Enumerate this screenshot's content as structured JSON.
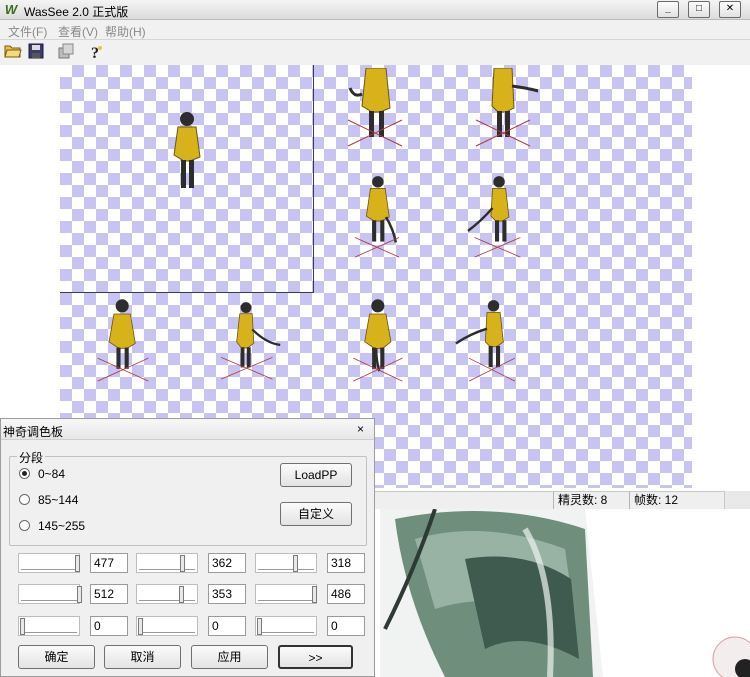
{
  "window": {
    "title": "WasSee 2.0 正式版"
  },
  "menu": {
    "file": "文件(F)",
    "view": "查看(V)",
    "help": "帮助(H)"
  },
  "status": {
    "sprites": "精灵数: 8",
    "frames": "帧数: 12"
  },
  "palette": {
    "title": "神奇调色板",
    "close": "×",
    "group_label": "分段",
    "ranges": [
      "0~84",
      "85~144",
      "145~255"
    ],
    "selected_range": "0~84",
    "load_label": "LoadPP",
    "custom_label": "自定义",
    "values": {
      "row1": [
        "477",
        "362",
        "318"
      ],
      "row2": [
        "512",
        "353",
        "486"
      ],
      "row3": [
        "0",
        "0",
        "0"
      ]
    },
    "ok_label": "确定",
    "cancel_label": "取消",
    "apply_label": "应用",
    "more_label": ">>"
  },
  "colors": {
    "checker": "#c7c3f2",
    "sprite_gold": "#d8b21a",
    "sprite_dark": "#2d2d2d",
    "crosshair": "#b23838",
    "preview_green": "#6f8f7c"
  }
}
